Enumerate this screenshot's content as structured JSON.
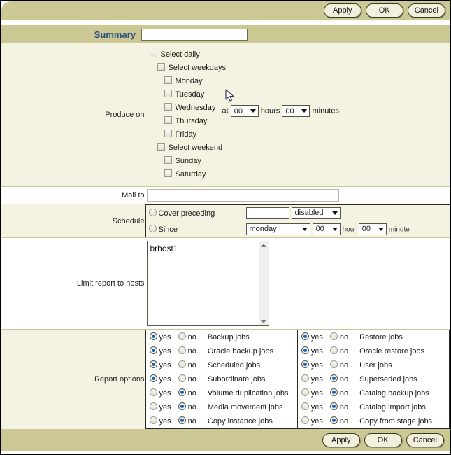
{
  "toolbar_top": {
    "buttons": [
      {
        "label": "Apply",
        "name": "apply-button-top"
      },
      {
        "label": "OK",
        "name": "ok-button-top"
      },
      {
        "label": "Cancel",
        "name": "cancel-button-top"
      }
    ]
  },
  "toolbar_bottom": {
    "buttons": [
      {
        "label": "Apply",
        "name": "apply-button-bottom"
      },
      {
        "label": "OK",
        "name": "ok-button-bottom"
      },
      {
        "label": "Cancel",
        "name": "cancel-button-bottom"
      }
    ]
  },
  "summary": {
    "label": "Summary",
    "value": "",
    "placeholder": ""
  },
  "produce_on": {
    "label": "Produce on",
    "checkboxes": [
      {
        "label": "Select daily",
        "checked": false,
        "indent": 1
      },
      {
        "label": "Select weekdays",
        "checked": false,
        "indent": 2
      },
      {
        "label": "Monday",
        "checked": false,
        "indent": 3
      },
      {
        "label": "Tuesday",
        "checked": false,
        "indent": 3
      },
      {
        "label": "Wednesday",
        "checked": false,
        "indent": 3
      },
      {
        "label": "Thursday",
        "checked": false,
        "indent": 3
      },
      {
        "label": "Friday",
        "checked": false,
        "indent": 3
      },
      {
        "label": "Select weekend",
        "checked": false,
        "indent": 2
      },
      {
        "label": "Sunday",
        "checked": false,
        "indent": 3
      },
      {
        "label": "Saturday",
        "checked": false,
        "indent": 3
      }
    ],
    "time": {
      "at_label": "at",
      "hours_value": "00",
      "hours_label": "hours",
      "minutes_value": "00",
      "minutes_label": "minutes"
    }
  },
  "mail_to": {
    "label": "Mail to",
    "value": "",
    "placeholder": ""
  },
  "schedule": {
    "label": "Schedule",
    "rows": [
      {
        "option_label": "Cover preceding",
        "selected": false,
        "text_value": "",
        "select_value": "disabled"
      },
      {
        "option_label": "Since",
        "selected": false,
        "day_value": "monday",
        "hour_value": "00",
        "hour_label": "hour",
        "minute_value": "00",
        "minute_label": "minute"
      }
    ]
  },
  "limit_hosts": {
    "label": "Limit report to hosts",
    "items": [
      "brhost1"
    ]
  },
  "report_options": {
    "label": "Report options",
    "yes_label": "yes",
    "no_label": "no",
    "left_column": [
      {
        "name": "Backup jobs",
        "value": "yes"
      },
      {
        "name": "Oracle backup jobs",
        "value": "yes"
      },
      {
        "name": "Scheduled jobs",
        "value": "yes"
      },
      {
        "name": "Subordinate jobs",
        "value": "yes"
      },
      {
        "name": "Volume duplication jobs",
        "value": "no"
      },
      {
        "name": "Media movement jobs",
        "value": "no"
      },
      {
        "name": "Copy instance jobs",
        "value": "no"
      }
    ],
    "right_column": [
      {
        "name": "Restore jobs",
        "value": "yes"
      },
      {
        "name": "Oracle restore jobs",
        "value": "yes"
      },
      {
        "name": "User jobs",
        "value": "yes"
      },
      {
        "name": "Superseded jobs",
        "value": "no"
      },
      {
        "name": "Catalog backup jobs",
        "value": "no"
      },
      {
        "name": "Catalog import jobs",
        "value": "no"
      },
      {
        "name": "Copy from stage jobs",
        "value": "no"
      }
    ]
  },
  "colors": {
    "band": "#ccc893",
    "body": "#f4f3e2",
    "accent_text": "#2c4d82",
    "radio_dot": "#1166bb"
  }
}
